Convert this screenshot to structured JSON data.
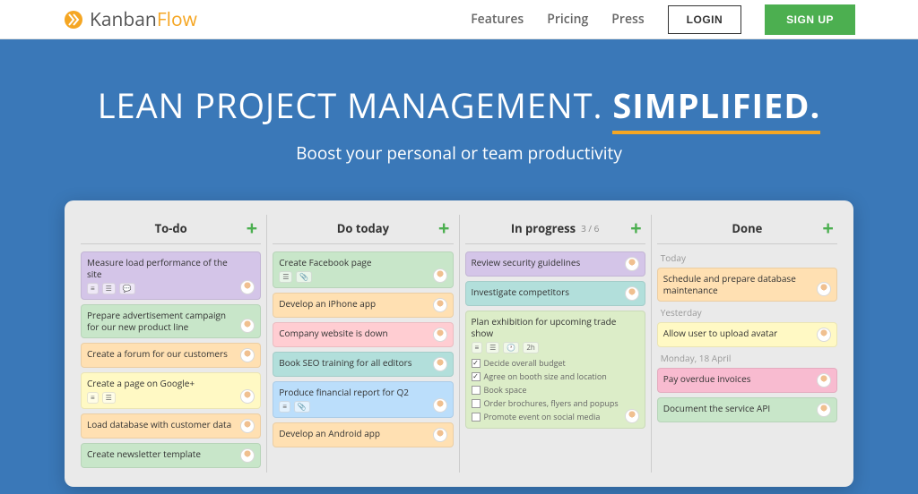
{
  "brand": {
    "name1": "Kanban",
    "name2": "Flow"
  },
  "nav": {
    "features": "Features",
    "pricing": "Pricing",
    "press": "Press",
    "login": "LOGIN",
    "signup": "SIGN UP"
  },
  "hero": {
    "title_pre": "LEAN PROJECT MANAGEMENT. ",
    "title_bold": "SIMPLIFIED.",
    "subtitle": "Boost your personal or team productivity"
  },
  "columns": [
    {
      "title": "To-do",
      "cards": [
        {
          "title": "Measure load performance of the site",
          "color": "c-purple",
          "meta": [
            "≡",
            "☰",
            "💬"
          ]
        },
        {
          "title": "Prepare advertisement campaign for our new product line",
          "color": "c-green"
        },
        {
          "title": "Create a forum for our customers",
          "color": "c-orange"
        },
        {
          "title": "Create a page on Google+",
          "color": "c-yellow",
          "meta": [
            "≡",
            "☰"
          ]
        },
        {
          "title": "Load database with customer data",
          "color": "c-orange"
        },
        {
          "title": "Create newsletter template",
          "color": "c-green"
        }
      ]
    },
    {
      "title": "Do today",
      "cards": [
        {
          "title": "Create Facebook page",
          "color": "c-green",
          "meta": [
            "☰",
            "📎"
          ]
        },
        {
          "title": "Develop an iPhone app",
          "color": "c-orange"
        },
        {
          "title": "Company website is down",
          "color": "c-red"
        },
        {
          "title": "Book SEO training for all editors",
          "color": "c-teal"
        },
        {
          "title": "Produce financial report for Q2",
          "color": "c-blue",
          "meta": [
            "≡",
            "📎"
          ]
        },
        {
          "title": "Develop an Android app",
          "color": "c-orange"
        }
      ]
    },
    {
      "title": "In progress",
      "count": "3 / 6",
      "cards": [
        {
          "title": "Review security guidelines",
          "color": "c-purple"
        },
        {
          "title": "Investigate competitors",
          "color": "c-teal"
        },
        {
          "title": "Plan exhibition for upcoming trade show",
          "color": "c-lightgreen",
          "meta": [
            "≡",
            "☰",
            "🕐",
            "2h"
          ],
          "subtasks": [
            {
              "label": "Decide overall budget",
              "checked": true
            },
            {
              "label": "Agree on booth size and location",
              "checked": true
            },
            {
              "label": "Book space",
              "checked": false
            },
            {
              "label": "Order brochures, flyers and popups",
              "checked": false
            },
            {
              "label": "Promote event on social media",
              "checked": false
            }
          ]
        }
      ]
    },
    {
      "title": "Done",
      "groups": [
        {
          "label": "Today",
          "cards": [
            {
              "title": "Schedule and prepare database maintenance",
              "color": "c-orange"
            }
          ]
        },
        {
          "label": "Yesterday",
          "cards": [
            {
              "title": "Allow user to upload avatar",
              "color": "c-yellow"
            }
          ]
        },
        {
          "label": "Monday, 18 April",
          "cards": [
            {
              "title": "Pay overdue invoices",
              "color": "c-pink"
            },
            {
              "title": "Document the service API",
              "color": "c-green"
            }
          ]
        }
      ]
    }
  ]
}
